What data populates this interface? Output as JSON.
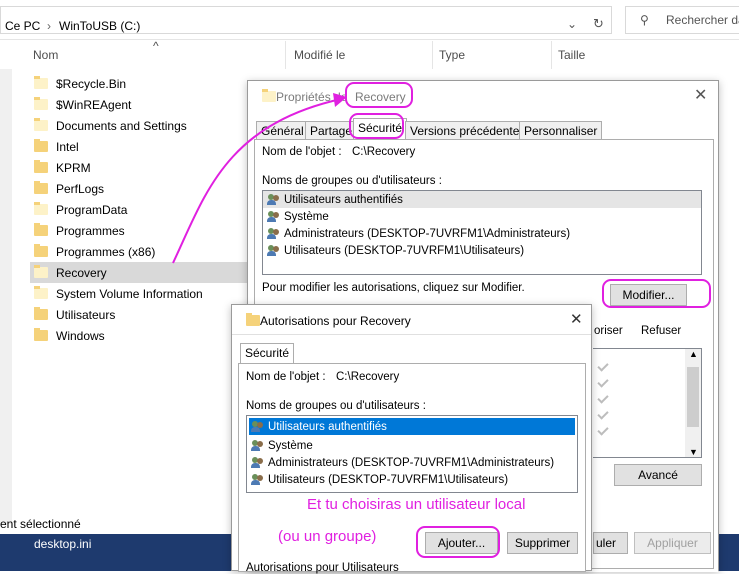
{
  "explorer": {
    "breadcrumb": [
      "Ce PC",
      "WinToUSB (C:)"
    ],
    "search_placeholder": "Rechercher da",
    "columns": [
      "Nom",
      "Modifié le",
      "Type",
      "Taille"
    ],
    "files": [
      {
        "name": "$Recycle.Bin"
      },
      {
        "name": "$WinREAgent"
      },
      {
        "name": "Documents and Settings"
      },
      {
        "name": "Intel"
      },
      {
        "name": "KPRM"
      },
      {
        "name": "PerfLogs"
      },
      {
        "name": "ProgramData"
      },
      {
        "name": "Programmes"
      },
      {
        "name": "Programmes (x86)"
      },
      {
        "name": "Recovery",
        "selected": true
      },
      {
        "name": "System Volume Information"
      },
      {
        "name": "Utilisateurs"
      },
      {
        "name": "Windows"
      }
    ],
    "status": "ent sélectionné",
    "desktop_item": "desktop.ini"
  },
  "props_dialog": {
    "title_prefix": "Propriétés de",
    "title_name": "Recovery",
    "tabs": [
      "Général",
      "Partage",
      "Sécurité",
      "Versions précédentes",
      "Personnaliser"
    ],
    "object_label": "Nom de l'objet :",
    "object_value": "C:\\Recovery",
    "groups_label": "Noms de groupes ou d'utilisateurs :",
    "users": [
      "Utilisateurs authentifiés",
      "Système",
      "Administrateurs (DESKTOP-7UVRFM1\\Administrateurs)",
      "Utilisateurs (DESKTOP-7UVRFM1\\Utilisateurs)"
    ],
    "modify_hint": "Pour modifier les autorisations, cliquez sur Modifier.",
    "modify_button": "Modifier...",
    "col_allow_partial": "oriser",
    "col_deny": "Refuser",
    "advanced_button": "Avancé",
    "cancel_partial": "uler",
    "apply_button": "Appliquer"
  },
  "perm_dialog": {
    "title": "Autorisations pour Recovery",
    "tab": "Sécurité",
    "object_label": "Nom de l'objet :",
    "object_value": "C:\\Recovery",
    "groups_label": "Noms de groupes ou d'utilisateurs :",
    "users": [
      "Utilisateurs authentifiés",
      "Système",
      "Administrateurs (DESKTOP-7UVRFM1\\Administrateurs)",
      "Utilisateurs (DESKTOP-7UVRFM1\\Utilisateurs)"
    ],
    "add_button": "Ajouter...",
    "remove_button": "Supprimer",
    "perm_for_label": "Autorisations pour Utilisateurs"
  },
  "annotations": {
    "note1": "Et tu choisiras un utilisateur local",
    "note2": "(ou un groupe)",
    "color": "#e020e0"
  }
}
